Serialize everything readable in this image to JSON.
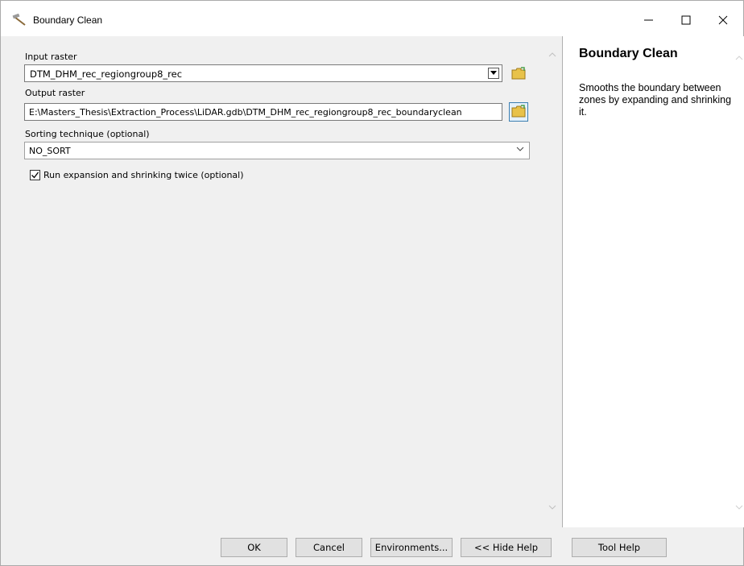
{
  "window": {
    "title": "Boundary Clean",
    "icon": "hammer-icon",
    "controls": {
      "minimize": "minimize-icon",
      "maximize": "maximize-icon",
      "close": "close-icon"
    }
  },
  "params": {
    "input_raster": {
      "label": "Input raster",
      "value": "DTM_DHM_rec_regiongroup8_rec"
    },
    "output_raster": {
      "label": "Output raster",
      "value": "E:\\Masters_Thesis\\Extraction_Process\\LiDAR.gdb\\DTM_DHM_rec_regiongroup8_rec_boundaryclean"
    },
    "sorting": {
      "label": "Sorting technique (optional)",
      "value": "NO_SORT"
    },
    "run_twice": {
      "label": "Run expansion and shrinking twice (optional)",
      "checked": true
    }
  },
  "help": {
    "title": "Boundary Clean",
    "body": "Smooths the boundary between zones by expanding and shrinking it."
  },
  "buttons": {
    "ok": "OK",
    "cancel": "Cancel",
    "environments": "Environments...",
    "hide_help": "<< Hide Help",
    "tool_help": "Tool Help"
  },
  "colors": {
    "folder_yellow": "#e8c24a",
    "focus_blue": "#3c7fb1"
  }
}
